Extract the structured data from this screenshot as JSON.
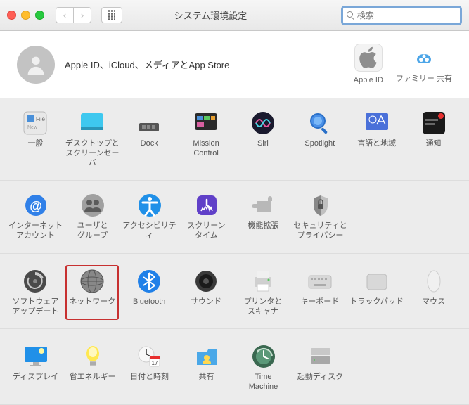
{
  "window": {
    "title": "システム環境設定",
    "search_placeholder": "検索"
  },
  "profile": {
    "text": "Apple ID、iCloud、メディアとApp Store",
    "apple_id": "Apple ID",
    "family": "ファミリー\n共有"
  },
  "rows": [
    [
      {
        "id": "general",
        "label": "一般",
        "icon": "general"
      },
      {
        "id": "desktop",
        "label": "デスクトップと\nスクリーンセーバ",
        "icon": "desktop"
      },
      {
        "id": "dock",
        "label": "Dock",
        "icon": "dock"
      },
      {
        "id": "mission",
        "label": "Mission\nControl",
        "icon": "mission"
      },
      {
        "id": "siri",
        "label": "Siri",
        "icon": "siri"
      },
      {
        "id": "spotlight",
        "label": "Spotlight",
        "icon": "spotlight"
      },
      {
        "id": "language",
        "label": "言語と地域",
        "icon": "language"
      },
      {
        "id": "notifications",
        "label": "通知",
        "icon": "notifications"
      }
    ],
    [
      {
        "id": "internet",
        "label": "インターネット\nアカウント",
        "icon": "internet"
      },
      {
        "id": "users",
        "label": "ユーザと\nグループ",
        "icon": "users"
      },
      {
        "id": "accessibility",
        "label": "アクセシビリティ",
        "icon": "accessibility"
      },
      {
        "id": "screentime",
        "label": "スクリーン\nタイム",
        "icon": "screentime"
      },
      {
        "id": "extensions",
        "label": "機能拡張",
        "icon": "extensions"
      },
      {
        "id": "security",
        "label": "セキュリティと\nプライバシー",
        "icon": "security"
      }
    ],
    [
      {
        "id": "update",
        "label": "ソフトウェア\nアップデート",
        "icon": "update"
      },
      {
        "id": "network",
        "label": "ネットワーク",
        "icon": "network",
        "highlight": true
      },
      {
        "id": "bluetooth",
        "label": "Bluetooth",
        "icon": "bluetooth"
      },
      {
        "id": "sound",
        "label": "サウンド",
        "icon": "sound"
      },
      {
        "id": "printers",
        "label": "プリンタと\nスキャナ",
        "icon": "printers"
      },
      {
        "id": "keyboard",
        "label": "キーボード",
        "icon": "keyboard"
      },
      {
        "id": "trackpad",
        "label": "トラックパッド",
        "icon": "trackpad"
      },
      {
        "id": "mouse",
        "label": "マウス",
        "icon": "mouse"
      }
    ],
    [
      {
        "id": "displays",
        "label": "ディスプレイ",
        "icon": "displays"
      },
      {
        "id": "energy",
        "label": "省エネルギー",
        "icon": "energy"
      },
      {
        "id": "datetime",
        "label": "日付と時刻",
        "icon": "datetime"
      },
      {
        "id": "sharing",
        "label": "共有",
        "icon": "sharing"
      },
      {
        "id": "timemachine",
        "label": "Time\nMachine",
        "icon": "timemachine"
      },
      {
        "id": "startup",
        "label": "起動ディスク",
        "icon": "startup"
      }
    ]
  ]
}
